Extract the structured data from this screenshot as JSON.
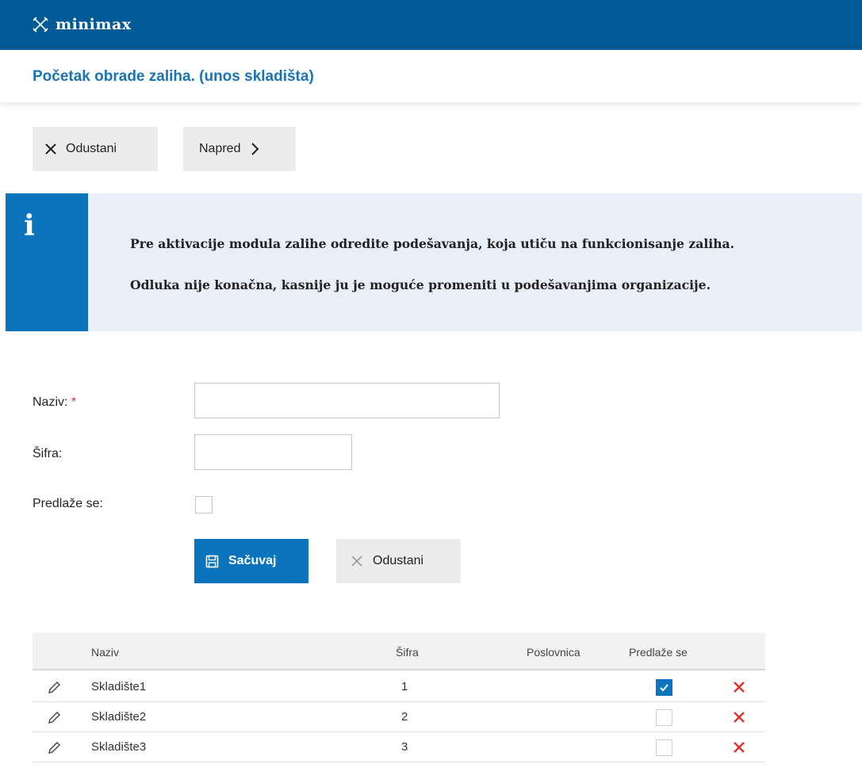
{
  "header": {
    "logo_text": "minimax",
    "logo_icon": "minimax-logo-icon",
    "brand_color": "#005a96"
  },
  "page": {
    "title": "Početak obrade zaliha. (unos skladišta)"
  },
  "toolbar": {
    "cancel_label": "Odustani",
    "next_label": "Napred"
  },
  "info": {
    "icon": "info-icon",
    "line1": "Pre aktivacije modula zalihe odredite podešavanja, koja utiču na funkcionisanje zaliha.",
    "line2": "Odluka nije konačna, kasnije ju je moguće promeniti u podešavanjima organizacije."
  },
  "form": {
    "name_label": "Naziv:",
    "name_required_mark": "*",
    "name_value": "",
    "code_label": "Šifra:",
    "code_value": "",
    "suggested_label": "Predlaže se:",
    "suggested_checked": false,
    "save_label": "Sačuvaj",
    "cancel_label": "Odustani"
  },
  "table": {
    "headers": {
      "name": "Naziv",
      "code": "Šifra",
      "branch": "Poslovnica",
      "suggested": "Predlaže se"
    },
    "rows": [
      {
        "name": "Skladište1",
        "code": "1",
        "branch": "",
        "suggested": true
      },
      {
        "name": "Skladište2",
        "code": "2",
        "branch": "",
        "suggested": false
      },
      {
        "name": "Skladište3",
        "code": "3",
        "branch": "",
        "suggested": false
      }
    ]
  },
  "colors": {
    "accent": "#0b74bd",
    "title": "#1a73b5",
    "delete": "#e0312c",
    "info_bg": "#e9eff8"
  }
}
